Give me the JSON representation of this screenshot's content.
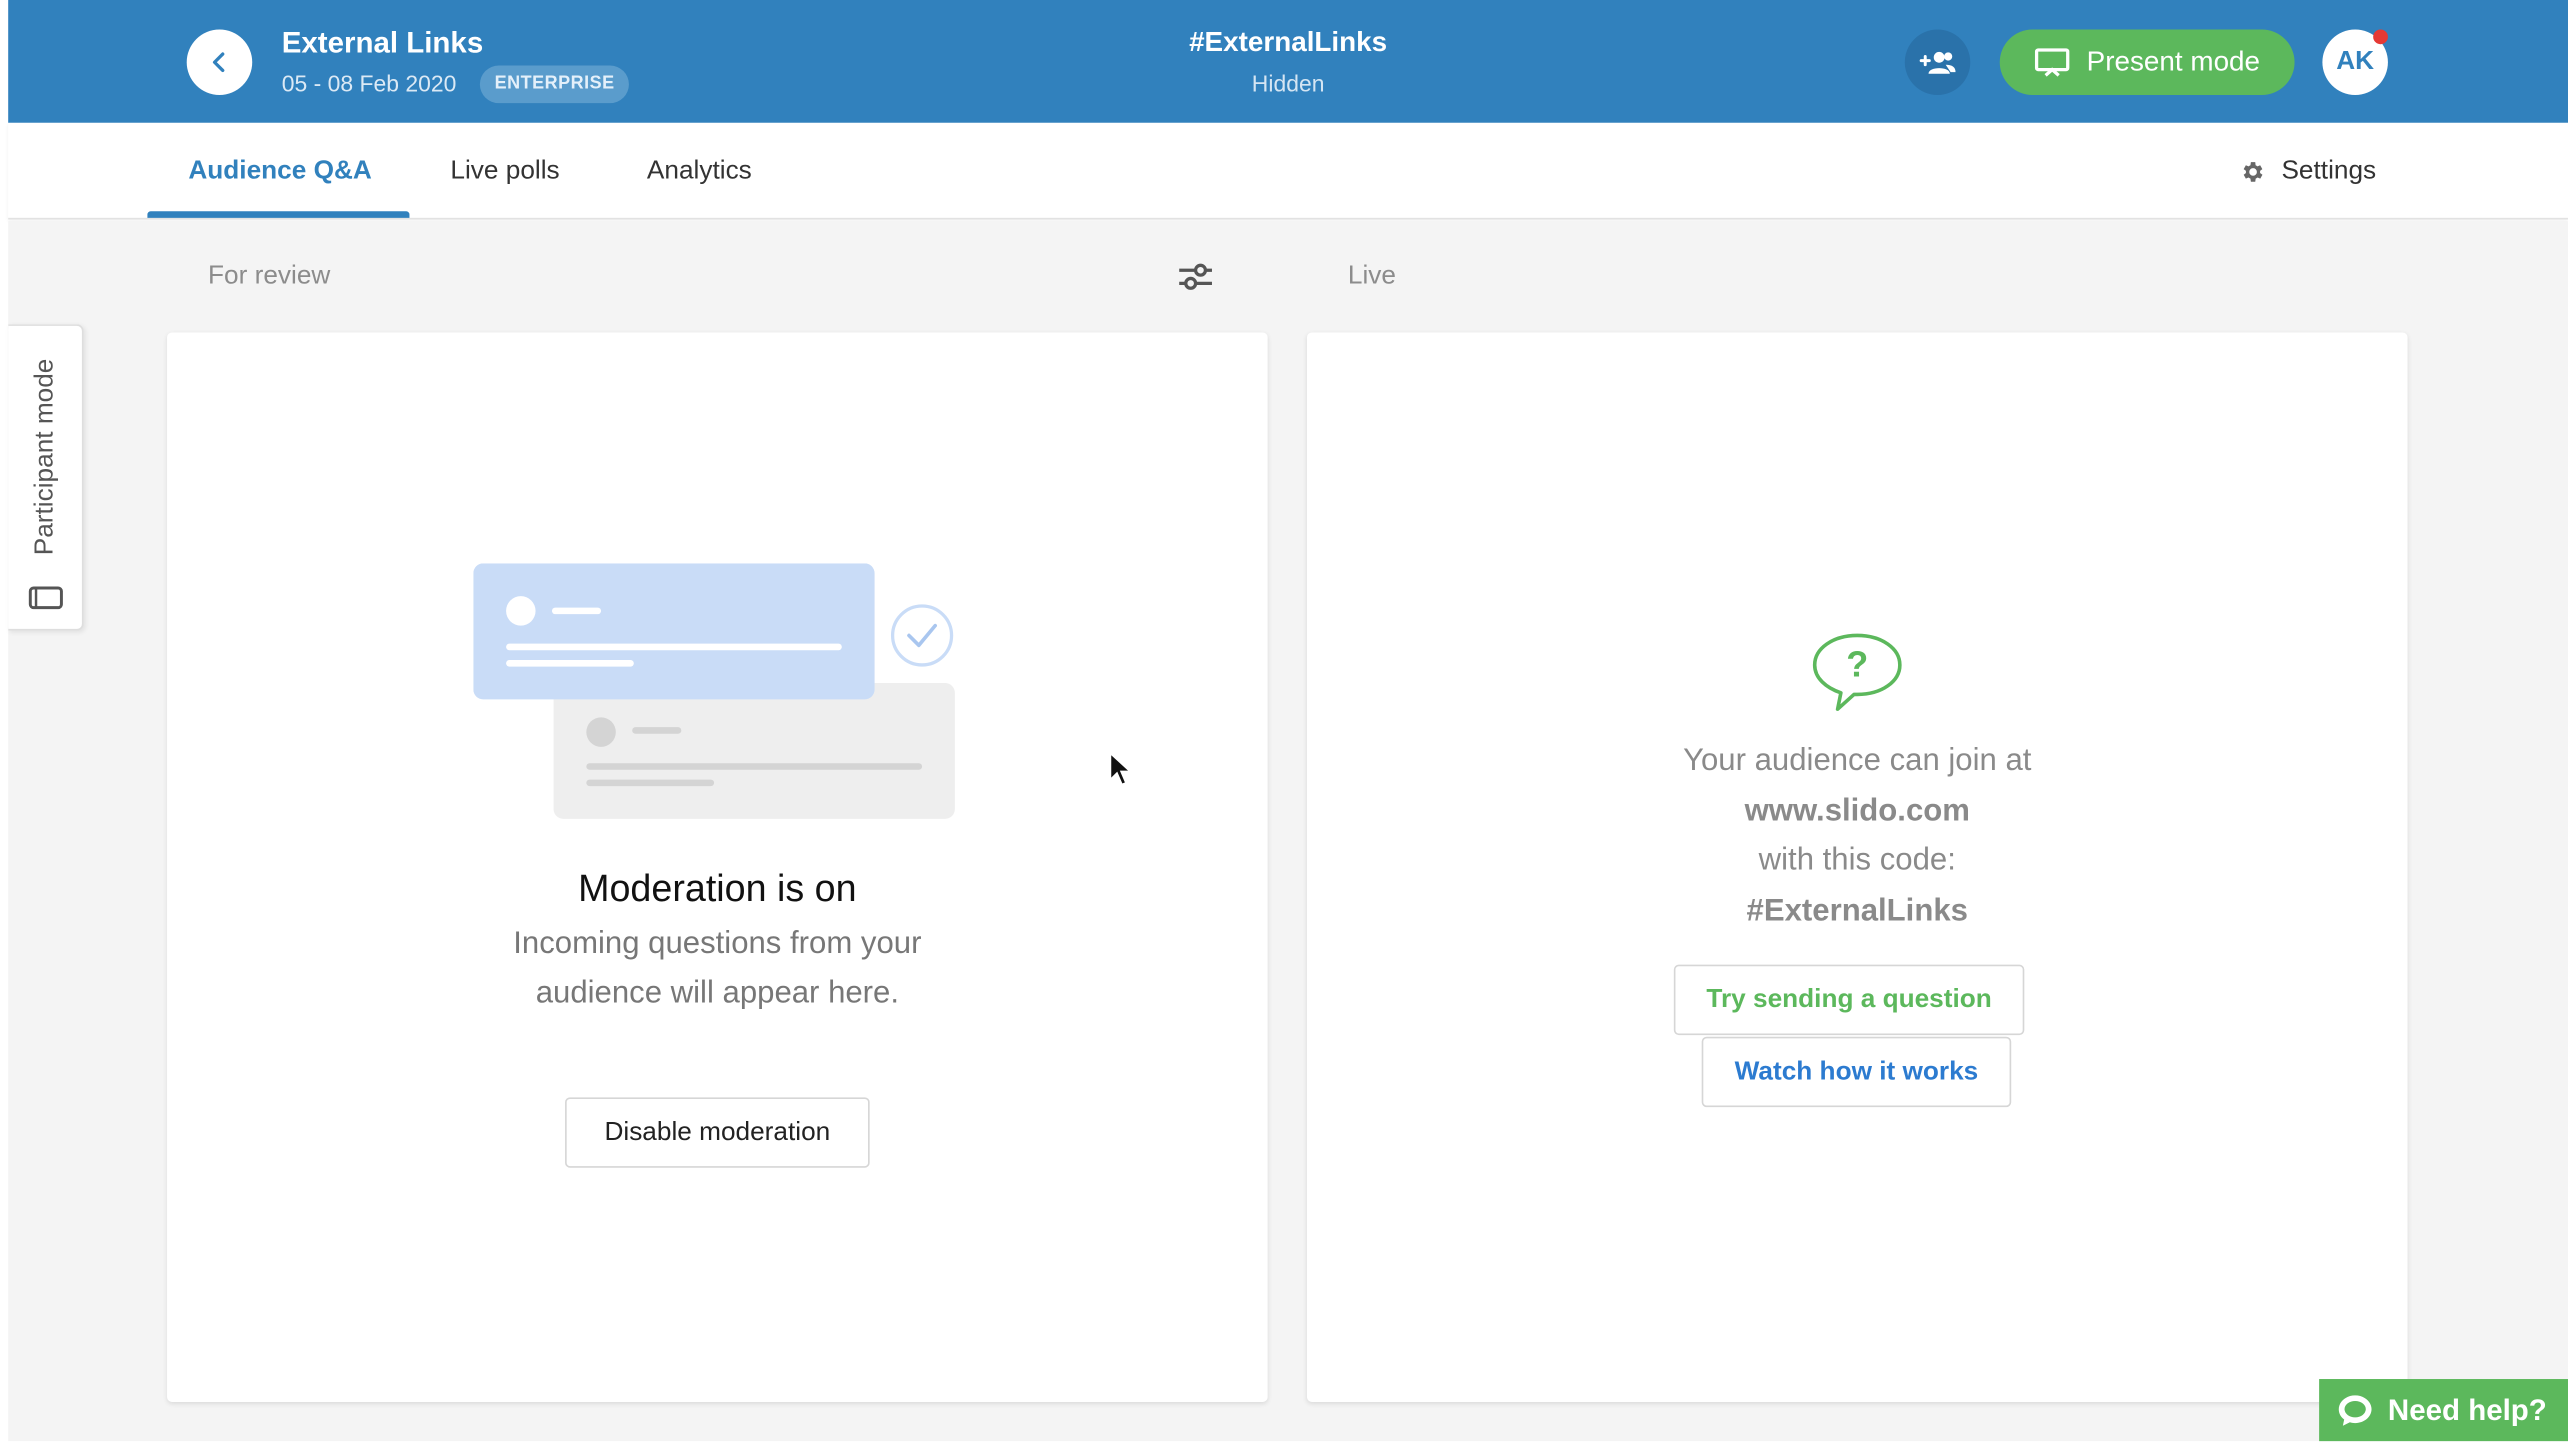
{
  "header": {
    "event_title": "External Links",
    "event_dates": "05 - 08 Feb 2020",
    "plan_badge": "ENTERPRISE",
    "event_code": "#ExternalLinks",
    "visibility": "Hidden",
    "present_label": "Present mode",
    "avatar_initials": "AK",
    "brand_color": "#3181bd"
  },
  "tabs": [
    {
      "label": "Audience Q&A",
      "active": true
    },
    {
      "label": "Live polls",
      "active": false
    },
    {
      "label": "Analytics",
      "active": false
    }
  ],
  "settings_label": "Settings",
  "columns": {
    "review_label": "For review",
    "live_label": "Live"
  },
  "moderation": {
    "title": "Moderation is on",
    "description": "Incoming questions from your audience will appear here.",
    "button_label": "Disable moderation"
  },
  "live_panel": {
    "line1": "Your audience can join at",
    "url": "www.slido.com",
    "line3": "with this code:",
    "code": "#ExternalLinks",
    "try_label": "Try sending a question",
    "watch_label": "Watch how it works",
    "accent_green": "#5cb85c"
  },
  "side_tab": {
    "label": "Participant mode"
  },
  "help": {
    "label": "Need help?"
  }
}
